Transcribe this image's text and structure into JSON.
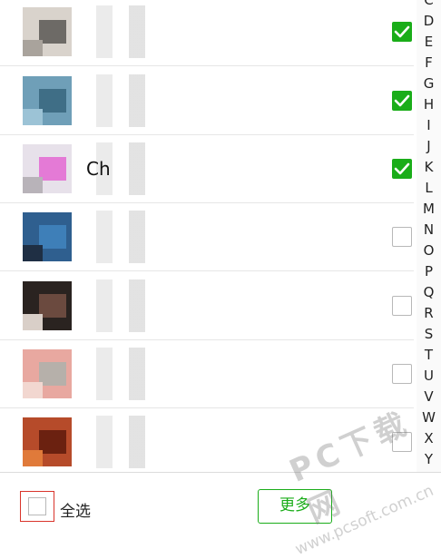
{
  "contacts": [
    {
      "name": "",
      "checked": true,
      "avatar_colors": [
        "#d9d3cc",
        "#6d6a66",
        "#a9a39c"
      ]
    },
    {
      "name": "",
      "checked": true,
      "avatar_colors": [
        "#6f9fb8",
        "#3f6e86",
        "#9cc3d6"
      ]
    },
    {
      "name": "Ch",
      "checked": true,
      "avatar_colors": [
        "#e7e1ea",
        "#e47ad6",
        "#b8b3b9"
      ]
    },
    {
      "name": "",
      "checked": false,
      "avatar_colors": [
        "#2f5f8f",
        "#3e7fb8",
        "#1f2f44"
      ]
    },
    {
      "name": "",
      "checked": false,
      "avatar_colors": [
        "#2a2320",
        "#6b4a3f",
        "#d9cfc8"
      ]
    },
    {
      "name": "",
      "checked": false,
      "avatar_colors": [
        "#e8a8a0",
        "#b6b0aa",
        "#f2d7d0"
      ]
    },
    {
      "name": "",
      "checked": false,
      "avatar_colors": [
        "#b64b2a",
        "#6b2110",
        "#e07a3a"
      ]
    }
  ],
  "alphabet": [
    "C",
    "D",
    "E",
    "F",
    "G",
    "H",
    "I",
    "J",
    "K",
    "L",
    "M",
    "N",
    "O",
    "P",
    "Q",
    "R",
    "S",
    "T",
    "U",
    "V",
    "W",
    "X",
    "Y"
  ],
  "footer": {
    "select_all_label": "全选",
    "more_button_label": "更多"
  },
  "watermark": {
    "brand": "PC下载网",
    "url": "www.pcsoft.com.cn"
  },
  "colors": {
    "accent_green": "#1aad19",
    "highlight_red": "#d9342b"
  }
}
